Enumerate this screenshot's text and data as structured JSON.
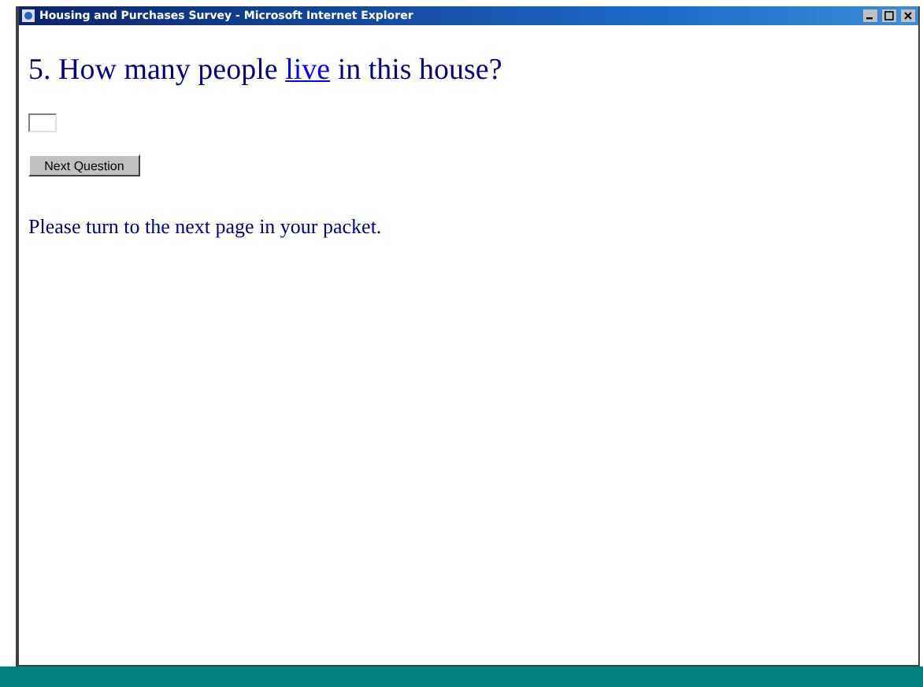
{
  "window": {
    "title": "Housing and Purchases Survey - Microsoft Internet Explorer"
  },
  "question": {
    "before": "5. How many people ",
    "link": "live",
    "after": " in this house?"
  },
  "button": "Next Question",
  "message": "Please turn to the next page in your packet."
}
